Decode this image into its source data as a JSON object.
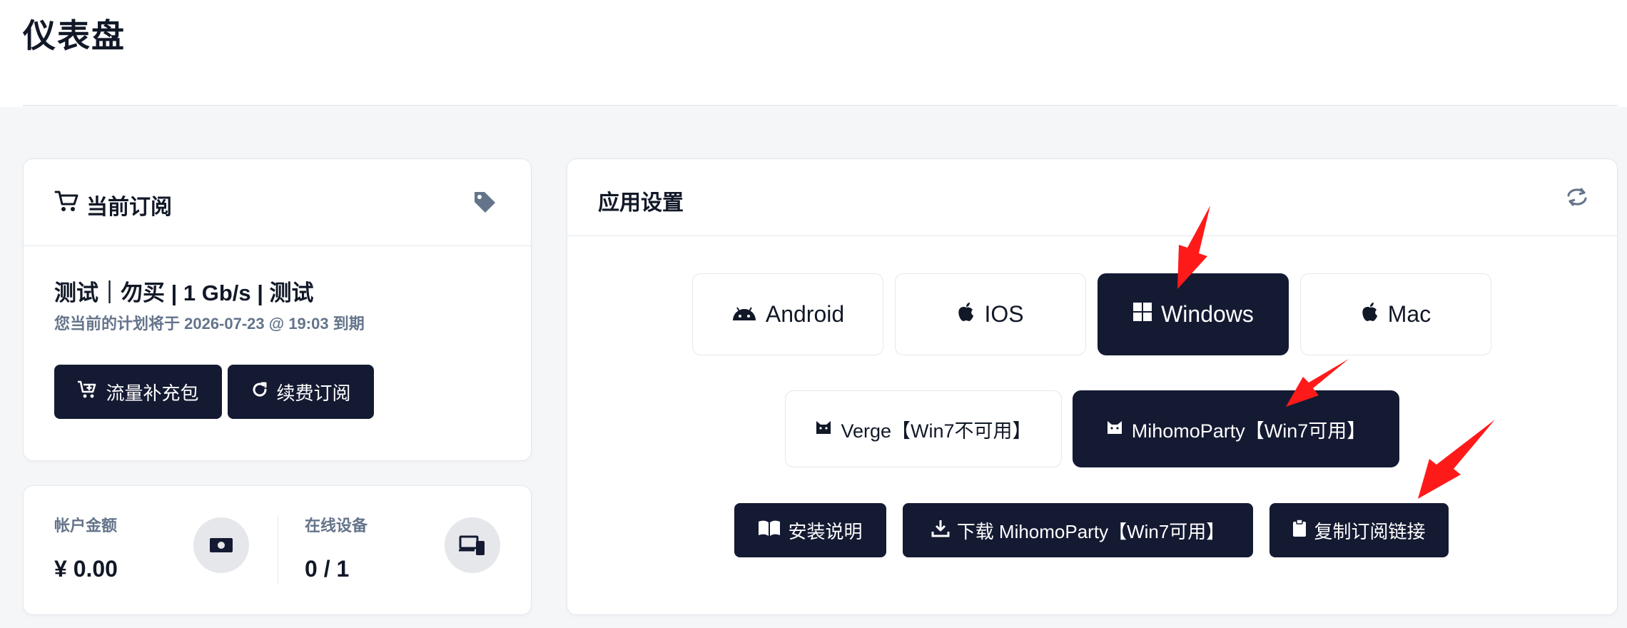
{
  "page": {
    "title": "仪表盘"
  },
  "subscription": {
    "heading": "当前订阅",
    "plan_name": "测试｜勿买 | 1 Gb/s | 测试",
    "expire_text": "您当前的计划将于 2026-07-23 @ 19:03 到期",
    "buttons": {
      "traffic": "流量补充包",
      "renew": "续费订阅"
    }
  },
  "stats": {
    "balance_label": "帐户金额",
    "balance_value": "¥ 0.00",
    "devices_label": "在线设备",
    "devices_value": "0 / 1"
  },
  "app_settings": {
    "heading": "应用设置",
    "platforms": [
      {
        "label": "Android",
        "icon": "android-icon"
      },
      {
        "label": "IOS",
        "icon": "apple-icon"
      },
      {
        "label": "Windows",
        "icon": "windows-icon",
        "selected": true
      },
      {
        "label": "Mac",
        "icon": "apple-icon"
      }
    ],
    "clients": [
      {
        "label": "Verge【Win7不可用】",
        "icon": "cat-icon"
      },
      {
        "label": "MihomoParty【Win7可用】",
        "icon": "cat-icon",
        "selected": true
      }
    ],
    "actions": {
      "install_guide": "安装说明",
      "download": "下载 MihomoParty【Win7可用】",
      "copy_link": "复制订阅链接"
    }
  },
  "colors": {
    "primary_dark": "#141a32",
    "annotation_red": "#ff1a1a",
    "muted_text": "#64748b"
  }
}
